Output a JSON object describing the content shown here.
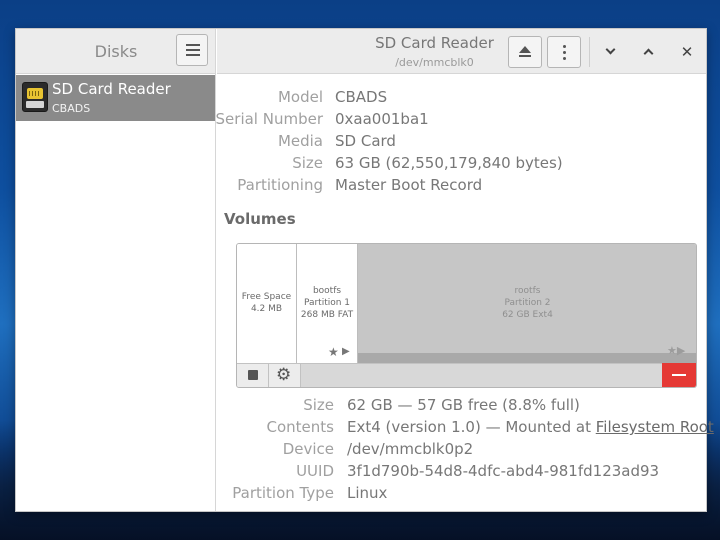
{
  "sidebar": {
    "title": "Disks",
    "drives": [
      {
        "name": "SD Card Reader",
        "subtitle": "CBADS",
        "icon": "sd-card-icon",
        "selected": true
      }
    ]
  },
  "header": {
    "title": "SD Card Reader",
    "subtitle": "/dev/mmcblk0",
    "icons": [
      "eject-icon",
      "more-options-icon",
      "minimize-icon",
      "maximize-icon",
      "close-icon"
    ],
    "close_glyph": "✕"
  },
  "drive_info": {
    "labels": {
      "model": "Model",
      "serial": "Serial Number",
      "media": "Media",
      "size": "Size",
      "partitioning": "Partitioning"
    },
    "values": {
      "model": "CBADS",
      "serial": "0xaa001ba1",
      "media": "SD Card",
      "size": "63 GB (62,550,179,840 bytes)",
      "partitioning": "Master Boot Record"
    }
  },
  "volumes": {
    "title": "Volumes",
    "partitions": [
      {
        "name": "Free Space",
        "size": "4.2 MB"
      },
      {
        "name": "bootfs",
        "partition": "Partition 1",
        "detail": "268 MB FAT"
      },
      {
        "name": "rootfs",
        "partition": "Partition 2",
        "detail": "62 GB Ext4",
        "selected": true
      }
    ],
    "markers": {
      "star": "★",
      "play": "▶",
      "root_icons": "★▶"
    },
    "toolbar_icons": [
      "stop-icon",
      "gear-icon",
      "delete-partition-icon"
    ],
    "gear_glyph": "⚙"
  },
  "partition_info": {
    "labels": {
      "size": "Size",
      "contents": "Contents",
      "device": "Device",
      "uuid": "UUID",
      "type": "Partition Type"
    },
    "values": {
      "size": "62 GB — 57 GB free (8.8% full)",
      "contents_prefix": "Ext4 (version 1.0) — Mounted at ",
      "contents_link": "Filesystem Root",
      "device": "/dev/mmcblk0p2",
      "uuid": "3f1d790b-54d8-4dfc-abd4-981fd123ad93",
      "type": "Linux"
    }
  },
  "colors": {
    "accent_delete": "#e53935",
    "selected_row": "#8a8a8a"
  }
}
